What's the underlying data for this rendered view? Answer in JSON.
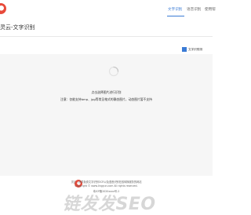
{
  "header": {
    "nav": [
      {
        "label": "文字识别",
        "active": true
      },
      {
        "label": "语音识别",
        "active": false
      },
      {
        "label": "使用帮",
        "active": false
      }
    ]
  },
  "page": {
    "title": "灵云-文字识别"
  },
  "upload": {
    "label": "文字识别测"
  },
  "dropzone": {
    "hint_primary": "点击选择图片进行识别",
    "hint_secondary": "注意：仅能支持bmp、jpg等常见格式的静态图片，动态图片暂不支持"
  },
  "footer": {
    "line1": "灵云 - 提供免费文字识别OCR以及语音识别在线转换服务的网站",
    "line2": "Copyright © www.lingyun.com All rights reserved.",
    "line3": "粤ICP备2020xxxx号-2"
  },
  "watermark": {
    "text": "链发发SEO"
  },
  "colors": {
    "accent": "#3a7bd5",
    "brand_red": "#e84a3a",
    "dropzone_bg": "#f6f6f6"
  }
}
